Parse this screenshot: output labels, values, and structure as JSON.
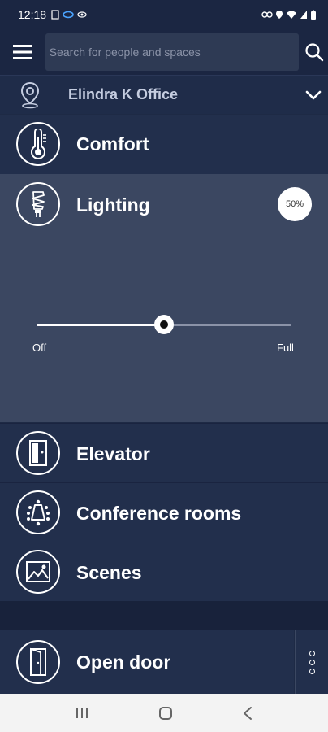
{
  "status_bar": {
    "time": "12:18"
  },
  "search": {
    "placeholder": "Search for people and spaces"
  },
  "location": {
    "name": "Elindra K Office"
  },
  "rows": {
    "comfort": "Comfort",
    "lighting": "Lighting",
    "elevator": "Elevator",
    "conference_rooms": "Conference rooms",
    "scenes": "Scenes",
    "open_door": "Open door"
  },
  "lighting": {
    "level_percent": 50,
    "badge_text": "50%",
    "min_label": "Off",
    "max_label": "Full"
  },
  "colors": {
    "background": "#1e2a45",
    "row": "#222f4c",
    "expanded_panel": "#3b4761",
    "icon": "#ffffff"
  },
  "icons": {
    "menu": "hamburger-icon",
    "search": "search-icon",
    "location": "location-pin-icon",
    "chevron": "chevron-down-icon",
    "comfort": "thermometer-icon",
    "lighting": "lightbulb-icon",
    "elevator": "elevator-icon",
    "conference": "conference-room-icon",
    "scenes": "image-icon",
    "door": "door-icon"
  }
}
